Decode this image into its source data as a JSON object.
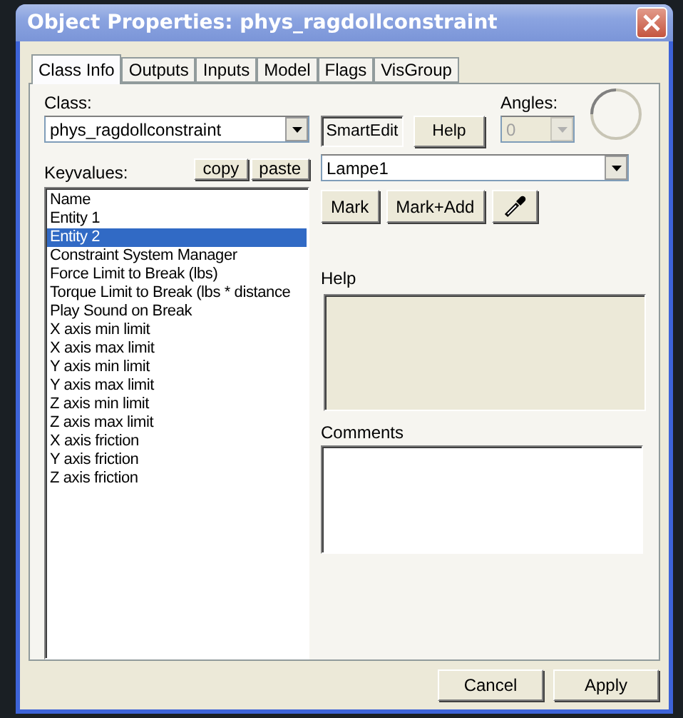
{
  "window": {
    "title": "Object Properties: phys_ragdollconstraint"
  },
  "tabs": [
    {
      "label": "Class Info",
      "selected": true
    },
    {
      "label": "Outputs",
      "selected": false
    },
    {
      "label": "Inputs",
      "selected": false
    },
    {
      "label": "Model",
      "selected": false
    },
    {
      "label": "Flags",
      "selected": false
    },
    {
      "label": "VisGroup",
      "selected": false
    }
  ],
  "class": {
    "label": "Class:",
    "value": "phys_ragdollconstraint"
  },
  "class_buttons": [
    {
      "label": "SmartEdit",
      "pressed": true
    },
    {
      "label": "Help",
      "pressed": false
    }
  ],
  "angles": {
    "label": "Angles:",
    "value": "0",
    "disabled": true
  },
  "keyvalues": {
    "label": "Keyvalues:",
    "buttons": [
      "copy",
      "paste"
    ],
    "items": [
      {
        "label": "Name",
        "selected": false
      },
      {
        "label": "Entity 1",
        "selected": false
      },
      {
        "label": "Entity 2",
        "selected": true
      },
      {
        "label": "Constraint System Manager",
        "selected": false
      },
      {
        "label": "Force Limit to Break (lbs)",
        "selected": false
      },
      {
        "label": "Torque Limit to Break (lbs * distance",
        "selected": false
      },
      {
        "label": "Play Sound on Break",
        "selected": false
      },
      {
        "label": "X axis min limit",
        "selected": false
      },
      {
        "label": "X axis max limit",
        "selected": false
      },
      {
        "label": "Y axis min limit",
        "selected": false
      },
      {
        "label": "Y axis max limit",
        "selected": false
      },
      {
        "label": "Z axis min limit",
        "selected": false
      },
      {
        "label": "Z axis max limit",
        "selected": false
      },
      {
        "label": "X axis friction",
        "selected": false
      },
      {
        "label": "Y axis friction",
        "selected": false
      },
      {
        "label": "Z axis friction",
        "selected": false
      }
    ]
  },
  "value": {
    "value": "Lampe1"
  },
  "mark_buttons": [
    {
      "kind": "text",
      "label": "Mark"
    },
    {
      "kind": "text",
      "label": "Mark+Add"
    },
    {
      "kind": "eyedropper"
    }
  ],
  "help": {
    "label": "Help"
  },
  "comments": {
    "label": "Comments"
  },
  "buttons": [
    "Cancel",
    "Apply"
  ]
}
